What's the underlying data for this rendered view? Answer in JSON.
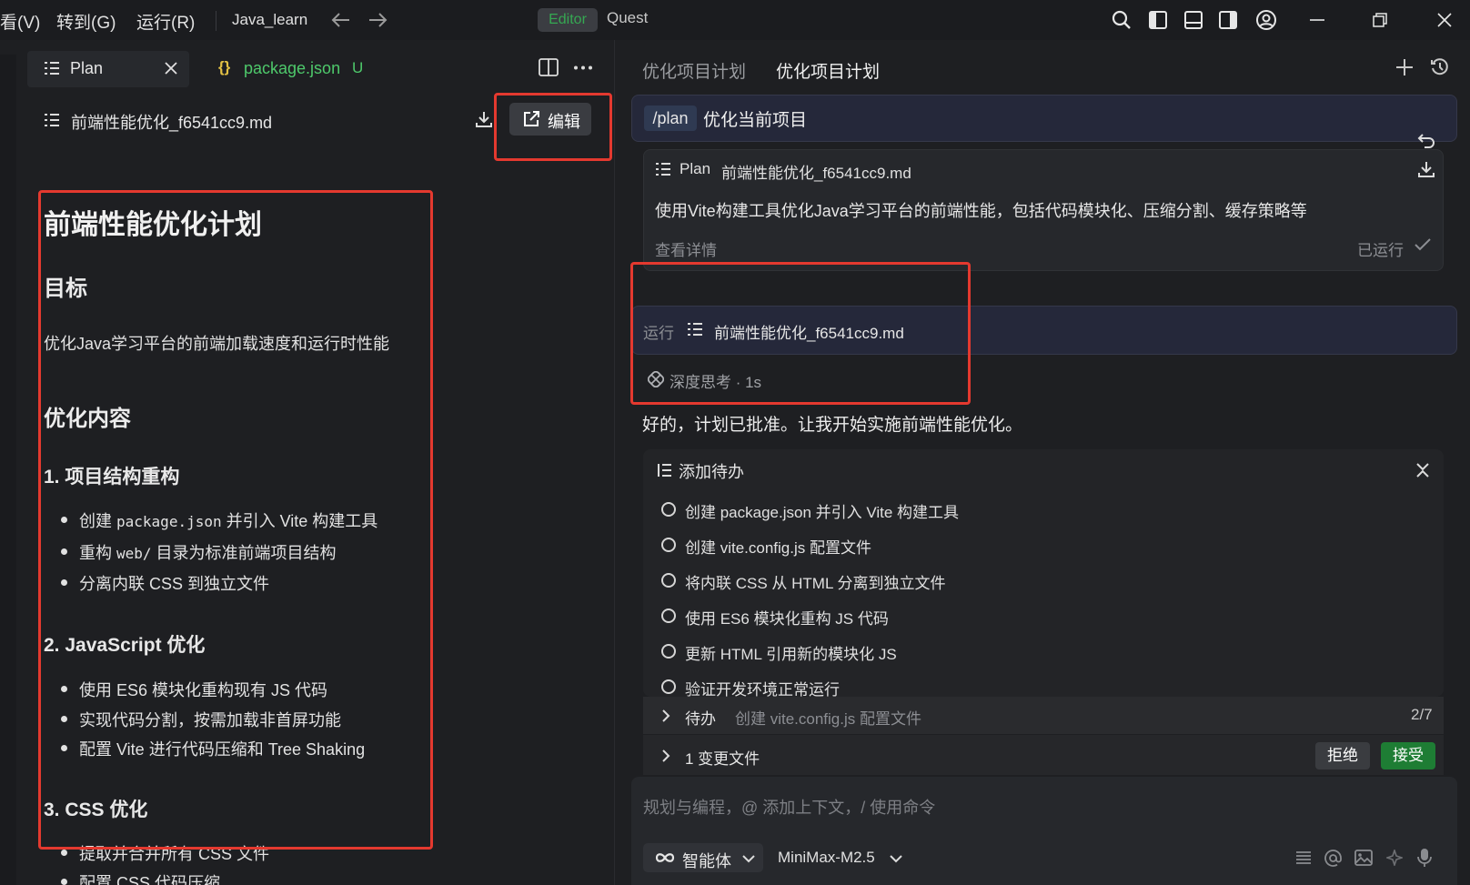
{
  "titlebar": {
    "menus": [
      "看(V)",
      "转到(G)",
      "运行(R)"
    ],
    "project": "Java_learn",
    "mode_editor": "Editor",
    "mode_quest": "Quest"
  },
  "editor": {
    "tabs": [
      {
        "label": "Plan"
      },
      {
        "label": "package.json",
        "badge": "U"
      }
    ],
    "file_name": "前端性能优化_f6541cc9.md",
    "edit_label": "编辑",
    "doc": {
      "h1": "前端性能优化计划",
      "goal_heading": "目标",
      "goal_text": "优化Java学习平台的前端加载速度和运行时性能",
      "content_heading": "优化内容",
      "sections": [
        {
          "heading": "1. 项目结构重构",
          "items": [
            {
              "pre": "创建 ",
              "code": "package.json",
              "post": " 并引入 Vite 构建工具"
            },
            {
              "pre": "重构 ",
              "code": "web/",
              "post": " 目录为标准前端项目结构"
            },
            {
              "pre": "分离内联 CSS 到独立文件",
              "code": "",
              "post": ""
            }
          ]
        },
        {
          "heading": "2. JavaScript 优化",
          "items": [
            {
              "pre": "使用 ES6 模块化重构现有 JS 代码",
              "code": "",
              "post": ""
            },
            {
              "pre": "实现代码分割，按需加载非首屏功能",
              "code": "",
              "post": ""
            },
            {
              "pre": "配置 Vite 进行代码压缩和 Tree Shaking",
              "code": "",
              "post": ""
            }
          ]
        },
        {
          "heading": "3. CSS 优化",
          "items": [
            {
              "pre": "提取并合并所有 CSS 文件",
              "code": "",
              "post": ""
            },
            {
              "pre": "配置 CSS 代码压缩",
              "code": "",
              "post": ""
            }
          ]
        }
      ]
    }
  },
  "chat": {
    "tabs": [
      "优化项目计划",
      "优化项目计划"
    ],
    "command": "/plan",
    "command_text": "优化当前项目",
    "plan_card": {
      "prefix": "Plan",
      "file": "前端性能优化_f6541cc9.md",
      "description": "使用Vite构建工具优化Java学习平台的前端性能，包括代码模块化、压缩分割、缓存策略等",
      "details": "查看详情",
      "status": "已运行"
    },
    "run_card": {
      "prefix": "运行",
      "file": "前端性能优化_f6541cc9.md"
    },
    "thinking": "深度思考 · 1s",
    "reply": "好的，计划已批准。让我开始实施前端性能优化。",
    "todo": {
      "title": "添加待办",
      "items": [
        "创建 package.json 并引入 Vite 构建工具",
        "创建 vite.config.js 配置文件",
        "将内联 CSS 从 HTML 分离到独立文件",
        "使用 ES6 模块化重构 JS 代码",
        "更新 HTML 引用新的模块化 JS",
        "验证开发环境正常运行"
      ]
    },
    "pending": {
      "label": "待办",
      "current": "创建 vite.config.js 配置文件",
      "progress": "2/7"
    },
    "changes": {
      "label": "1 变更文件",
      "reject": "拒绝",
      "accept": "接受"
    },
    "input": {
      "placeholder": "规划与编程，@ 添加上下文，/ 使用命令",
      "agent": "智能体",
      "model": "MiniMax-M2.5"
    }
  },
  "colors": {
    "accent_green": "#35a852",
    "highlight_red": "#e4392f",
    "accept_green": "#1e7d34"
  }
}
